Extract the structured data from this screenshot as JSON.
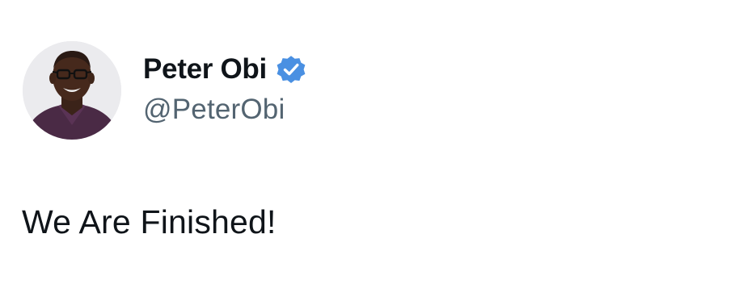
{
  "tweet": {
    "author": {
      "display_name": "Peter Obi",
      "handle": "@PeterObi",
      "avatar_icon": "profile-photo",
      "verified_icon": "verified-badge-icon",
      "verified_color": "#4a90e2"
    },
    "text": "We Are Finished!"
  },
  "colors": {
    "background": "#ffffff",
    "text_primary": "#0f1419",
    "text_secondary": "#536471"
  }
}
